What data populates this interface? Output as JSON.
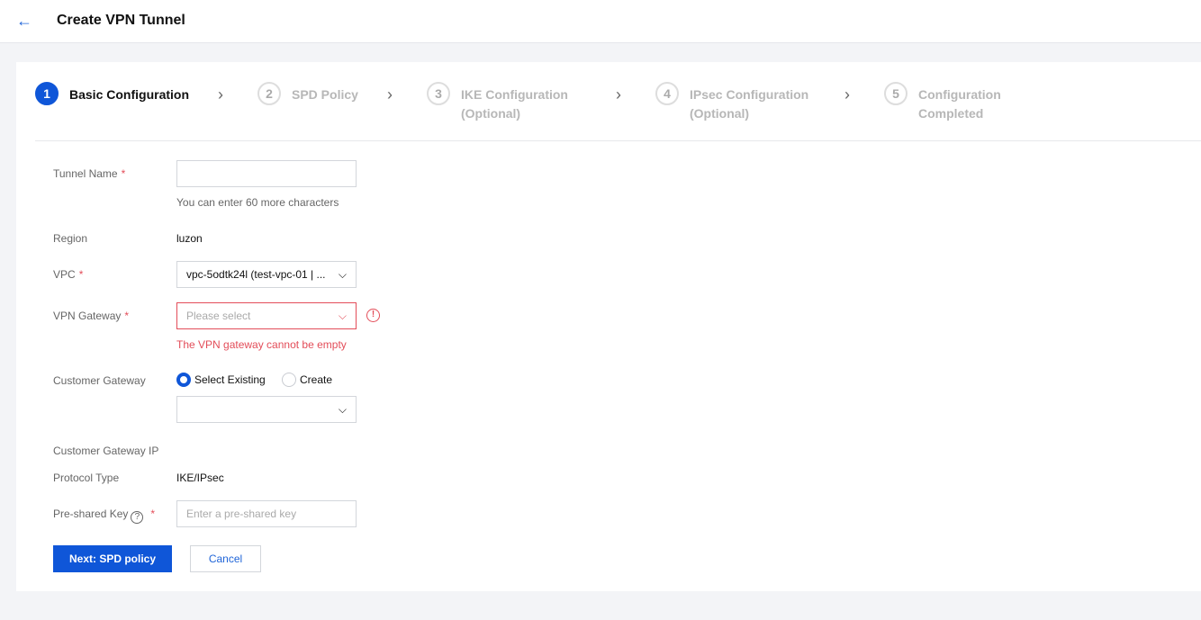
{
  "header": {
    "title": "Create VPN Tunnel",
    "back_icon": "arrow-left-icon"
  },
  "steps": [
    {
      "num": "1",
      "label_line1": "Basic Configuration",
      "label_line2": ""
    },
    {
      "num": "2",
      "label_line1": "SPD Policy",
      "label_line2": ""
    },
    {
      "num": "3",
      "label_line1": "IKE Configuration",
      "label_line2": "(Optional)"
    },
    {
      "num": "4",
      "label_line1": "IPsec Configuration",
      "label_line2": "(Optional)"
    },
    {
      "num": "5",
      "label_line1": "Configuration",
      "label_line2": "Completed"
    }
  ],
  "form": {
    "tunnel_name": {
      "label": "Tunnel Name",
      "value": "",
      "hint": "You can enter 60 more characters"
    },
    "region": {
      "label": "Region",
      "value": "luzon"
    },
    "vpc": {
      "label": "VPC",
      "value": "vpc-5odtk24l (test-vpc-01 | ..."
    },
    "vpn_gateway": {
      "label": "VPN Gateway",
      "placeholder": "Please select",
      "error": "The VPN gateway cannot be empty"
    },
    "customer_gateway": {
      "label": "Customer Gateway",
      "option_existing": "Select Existing",
      "option_create": "Create",
      "selected": "existing",
      "value": ""
    },
    "customer_gateway_ip": {
      "label": "Customer Gateway IP",
      "value": ""
    },
    "protocol_type": {
      "label": "Protocol Type",
      "value": "IKE/IPsec"
    },
    "pre_shared_key": {
      "label": "Pre-shared Key",
      "placeholder": "Enter a pre-shared key"
    }
  },
  "buttons": {
    "next": "Next: SPD policy",
    "cancel": "Cancel"
  },
  "colors": {
    "primary": "#0f56d8",
    "error": "#e34d59"
  }
}
